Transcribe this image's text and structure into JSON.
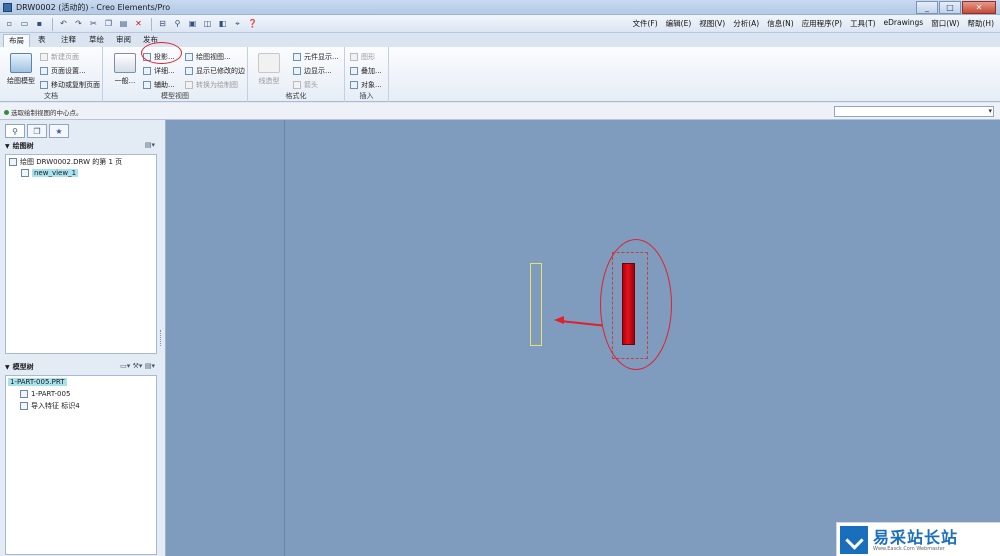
{
  "window": {
    "title": "DRW0002 (活动的) - Creo Elements/Pro",
    "controls": [
      "_",
      "□",
      "✕"
    ]
  },
  "quick_toolbar": {
    "icons": [
      "new-icon",
      "open-icon",
      "save-icon",
      "undo-icon",
      "redo-icon",
      "cut-icon",
      "copy-icon",
      "paste-icon",
      "delete-icon",
      "regenerate-icon",
      "find-icon",
      "window-icon",
      "display-icon",
      "model-display-icon",
      "datum-icon",
      "help-icon"
    ]
  },
  "menu": [
    "文件(F)",
    "编辑(E)",
    "视图(V)",
    "分析(A)",
    "信息(N)",
    "应用程序(P)",
    "工具(T)",
    "eDrawings",
    "窗口(W)",
    "帮助(H)"
  ],
  "ribbon_tabs": [
    "布局",
    "表",
    "注释",
    "草绘",
    "审阅",
    "发布"
  ],
  "ribbon": {
    "doc_group": {
      "big_button": "绘图模型",
      "items": [
        "新建页面",
        "页面设置...",
        "移动或复制页面"
      ],
      "label": "文档"
    },
    "model_view_group": {
      "big_button": "一般...",
      "col1": [
        "投影...",
        "详细...",
        "辅助..."
      ],
      "col2": [
        "绘图视图...",
        "显示已修改的边",
        "转换为绘制图"
      ],
      "label": "模型视图"
    },
    "format_group": {
      "big_button": "线造型",
      "items": [
        "元件显示...",
        "边显示...",
        "箭头"
      ],
      "label": "格式化"
    },
    "insert_group": {
      "items": [
        "图形",
        "叠加...",
        "对象..."
      ],
      "label": "插入"
    }
  },
  "message": "选取绘制视图的中心点。",
  "left_panel": {
    "drawing_tree": {
      "title": "绘图树",
      "items": [
        "绘图 DRW0002.DRW 的第 1 页",
        "new_view_1"
      ]
    },
    "model_tree": {
      "title": "模型树",
      "items": [
        "1-PART-005.PRT",
        "1-PART-005",
        "导入特征 标识4"
      ]
    }
  },
  "watermark": {
    "title": "易采站长站",
    "subtitle": "Www.Easck.Com  Webmaster"
  }
}
